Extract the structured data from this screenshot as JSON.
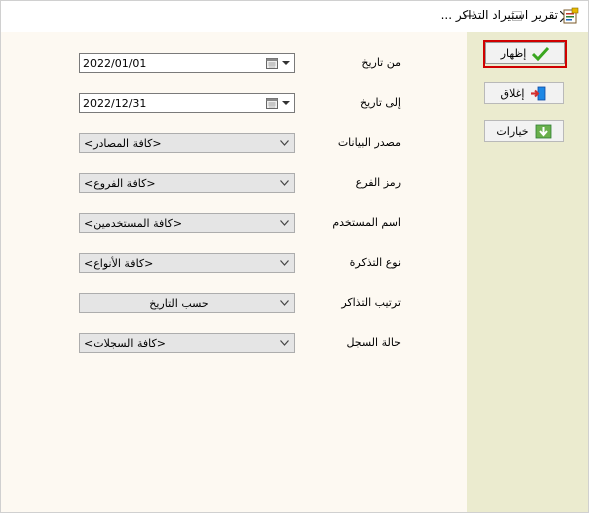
{
  "window": {
    "title": "تقرير استيراد التذاكر ...",
    "controls": {
      "minimize": "minimize",
      "maximize": "maximize",
      "close": "close"
    }
  },
  "sidebar": {
    "buttons": [
      {
        "label": "إظهار",
        "icon": "check-icon"
      },
      {
        "label": "إغلاق",
        "icon": "exit-door-icon"
      },
      {
        "label": "خيارات",
        "icon": "download-icon"
      }
    ]
  },
  "form": {
    "from_date": {
      "label": "من تاريخ",
      "value": "2022/01/01"
    },
    "to_date": {
      "label": "إلى تاريخ",
      "value": "2022/12/31"
    },
    "data_source": {
      "label": "مصدر البيانات",
      "value": "<كافة المصادر>"
    },
    "branch_code": {
      "label": "رمز الفرع",
      "value": "<كافة الفروع>"
    },
    "user_name": {
      "label": "اسم المستخدم",
      "value": "<كافة المستخدمين>"
    },
    "ticket_type": {
      "label": "نوع التذكرة",
      "value": "<كافة الأنواع>"
    },
    "ticket_sort": {
      "label": "ترتيب التذاكر",
      "value": "حسب التاريخ"
    },
    "record_status": {
      "label": "حالة السجل",
      "value": "<كافة السجلات>"
    }
  },
  "colors": {
    "client_bg": "#fdf9f2",
    "sidebar_bg": "#ebebcf",
    "focus_border": "#d00000",
    "check_green": "#3aa620"
  }
}
